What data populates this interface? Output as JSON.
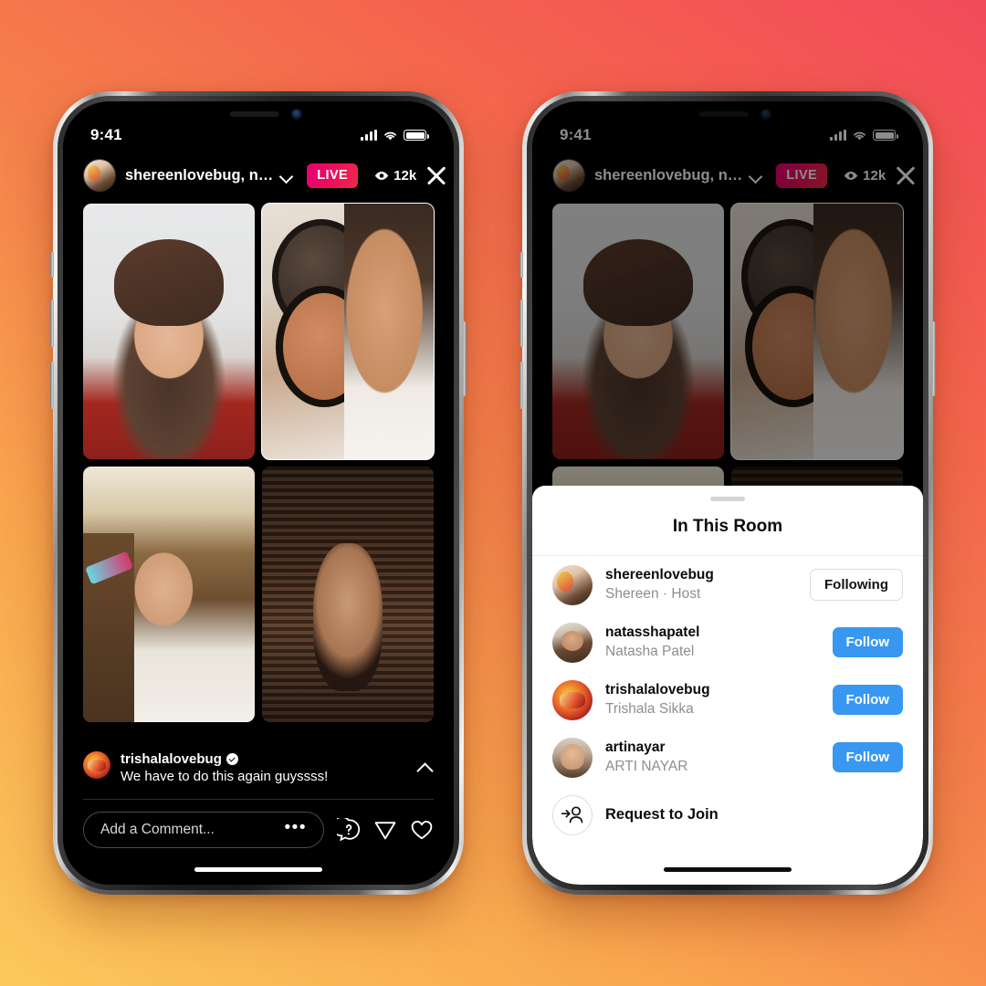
{
  "background": {
    "gradient_from": "#F24B5B",
    "gradient_to": "#FBC85B"
  },
  "accent": {
    "follow_blue": "#3897F0",
    "live_pink": "#E8006F",
    "live_red": "#F0294A"
  },
  "status_bar": {
    "time": "9:41",
    "signal_icon": "cellular-bars-icon",
    "wifi_icon": "wifi-icon",
    "battery_icon": "battery-full-icon"
  },
  "live_header": {
    "host_avatar": "shereenlovebug-avatar",
    "title": "shereenlovebug, n…",
    "chevron_icon": "chevron-down-icon",
    "live_label": "LIVE",
    "viewer_icon": "eye-icon",
    "viewer_count": "12k",
    "close_icon": "close-icon"
  },
  "video_grid": {
    "tiles": [
      {
        "name": "shereenlovebug-video",
        "active": false
      },
      {
        "name": "natasshapatel-video",
        "active": true
      },
      {
        "name": "trishalalovebug-video",
        "active": false
      },
      {
        "name": "artinayar-video",
        "active": false
      }
    ]
  },
  "comment": {
    "avatar": "trishalalovebug-avatar",
    "username": "trishalalovebug",
    "verified_icon": "verified-badge-icon",
    "text": "We have to do this again guyssss!",
    "collapse_icon": "chevron-up-icon"
  },
  "composer": {
    "placeholder": "Add a Comment...",
    "more_icon": "ellipsis-icon",
    "question_icon": "question-bubble-icon",
    "send_icon": "send-paper-plane-icon",
    "like_icon": "heart-icon"
  },
  "sheet": {
    "grabber": "drag-handle",
    "title": "In This Room",
    "people": [
      {
        "avatar": "shereenlovebug-avatar",
        "username": "shereenlovebug",
        "real_name": "Shereen · Host",
        "action": "Following",
        "action_style": "ghost"
      },
      {
        "avatar": "natasshapatel-avatar",
        "username": "natasshapatel",
        "real_name": "Natasha Patel",
        "action": "Follow",
        "action_style": "primary"
      },
      {
        "avatar": "trishalalovebug-avatar",
        "username": "trishalalovebug",
        "real_name": "Trishala Sikka",
        "action": "Follow",
        "action_style": "primary"
      },
      {
        "avatar": "artinayar-avatar",
        "username": "artinayar",
        "real_name": "ARTI NAYAR",
        "action": "Follow",
        "action_style": "primary"
      }
    ],
    "request_to_join": {
      "icon": "person-add-icon",
      "label": "Request to Join"
    }
  }
}
